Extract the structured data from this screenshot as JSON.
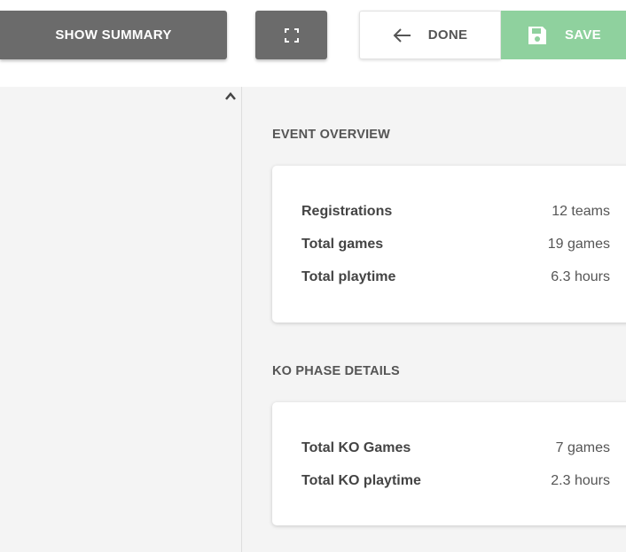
{
  "toolbar": {
    "show_summary_label": "SHOW SUMMARY",
    "done_label": "DONE",
    "save_label": "SAVE",
    "colors": {
      "dark_button": "#6b6b6b",
      "save_button": "#8fd19e"
    }
  },
  "summary": {
    "event_overview": {
      "title": "EVENT OVERVIEW",
      "rows": [
        {
          "label": "Registrations",
          "value": "12 teams"
        },
        {
          "label": "Total games",
          "value": "19 games"
        },
        {
          "label": "Total playtime",
          "value": "6.3 hours"
        }
      ]
    },
    "ko_phase": {
      "title": "KO PHASE DETAILS",
      "rows": [
        {
          "label": "Total KO Games",
          "value": "7 games"
        },
        {
          "label": "Total KO playtime",
          "value": "2.3 hours"
        }
      ]
    }
  },
  "icons": {
    "expand": "fullscreen-icon",
    "back": "arrow-left-icon",
    "save": "floppy-disk-icon",
    "collapse": "chevron-up-icon"
  }
}
